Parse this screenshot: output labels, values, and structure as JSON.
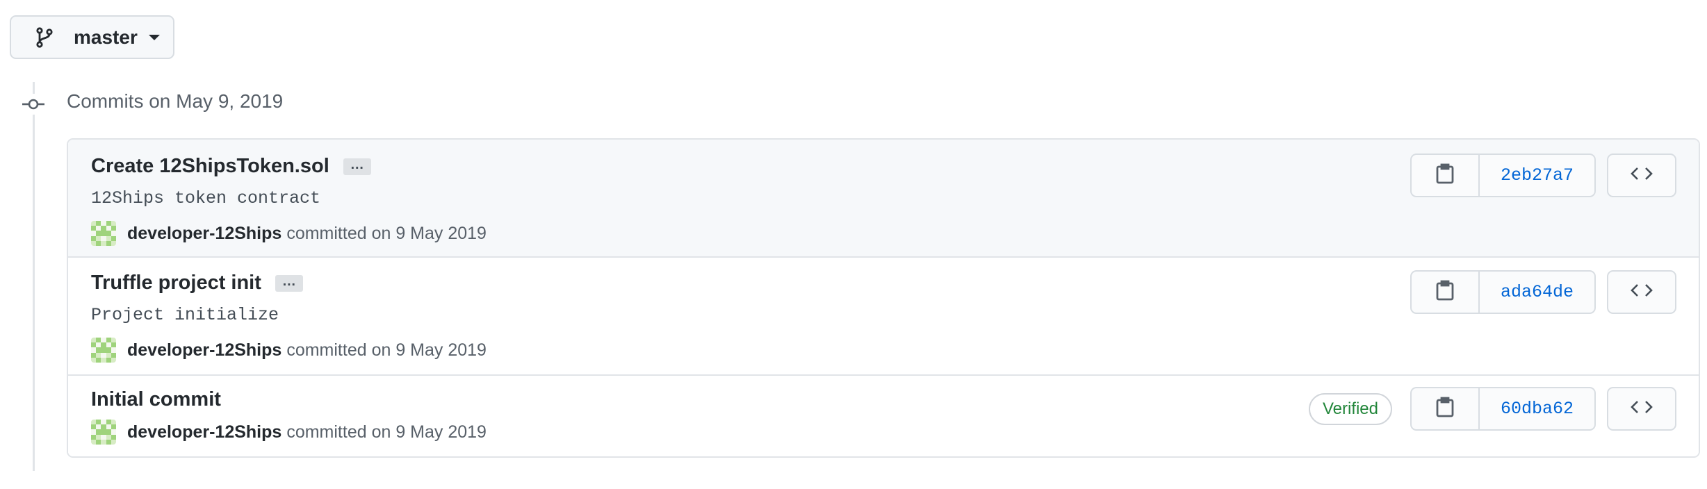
{
  "branch": {
    "label": "master",
    "icon": "git-branch-icon"
  },
  "timeline": {
    "title": "Commits on May 9, 2019",
    "icon": "git-commit-icon"
  },
  "commits": [
    {
      "title": "Create 12ShipsToken.sol",
      "has_ellipsis": true,
      "ellipsis_label": "…",
      "description": "12Ships token contract",
      "author": "developer-12Ships",
      "committed_text": "committed on 9 May 2019",
      "sha": "2eb27a7",
      "verified": false
    },
    {
      "title": "Truffle project init",
      "has_ellipsis": true,
      "ellipsis_label": "…",
      "description": "Project initialize",
      "author": "developer-12Ships",
      "committed_text": "committed on 9 May 2019",
      "sha": "ada64de",
      "verified": false
    },
    {
      "title": "Initial commit",
      "has_ellipsis": false,
      "description": "",
      "author": "developer-12Ships",
      "committed_text": "committed on 9 May 2019",
      "sha": "60dba62",
      "verified": true,
      "verified_label": "Verified"
    }
  ],
  "icons": {
    "copy": "clipboard-icon",
    "browse": "code-icon"
  },
  "colors": {
    "link": "#0366d6",
    "verified": "#22863a",
    "border": "#e1e4e8",
    "row_highlight": "#f6f8fa"
  }
}
